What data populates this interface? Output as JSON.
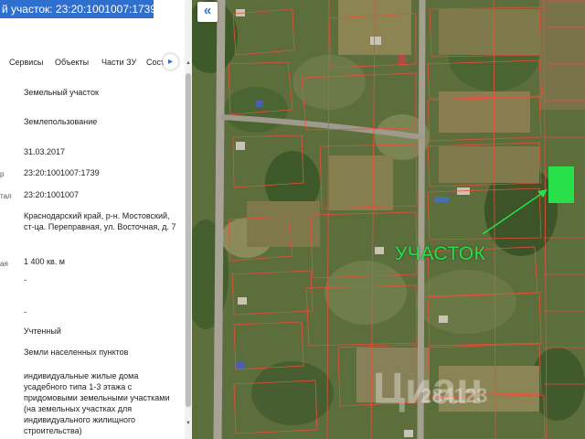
{
  "panel": {
    "title": "й участок: 23:20:1001007:1739",
    "tabs": [
      "Сервисы",
      "Объекты",
      "Части ЗУ",
      "Соста"
    ],
    "tab_next_icon": "chevron-right-icon",
    "rows": [
      {
        "label": "",
        "value": "Земельный участок"
      },
      {
        "label": "",
        "value": "Землепользование"
      },
      {
        "label": "",
        "value": "31.03.2017"
      },
      {
        "label": "р",
        "value": "23:20:1001007:1739"
      },
      {
        "label": "тал",
        "value": "23:20:1001007"
      },
      {
        "label": "",
        "value": "Краснодарский край, р-н. Мостовский, ст-ца. Переправная, ул. Восточная, д. 7"
      },
      {
        "label": "ая",
        "value": "1 400 кв. м"
      },
      {
        "label": "",
        "value": "-"
      },
      {
        "label": "",
        "value": "-"
      },
      {
        "label": "",
        "value": "Учтенный"
      },
      {
        "label": "",
        "value": "Земли населенных пунктов"
      },
      {
        "label": "",
        "value": "индивидуальные жилые дома усадебного типа 1-3 этажа с придомовыми земельными участками (на земельных участках для индивидуального жилищного строительства)"
      }
    ]
  },
  "map": {
    "collapse_icon": "double-chevron-left-icon",
    "collapse_label": "«",
    "parcel_label": "УЧАСТОК",
    "watermark_logo": "Циан",
    "watermark_id": "284123",
    "colors": {
      "accent": "#2f6fd0",
      "highlight": "#27e04a",
      "boundary": "#e8503a",
      "satellite_base": "#5d6e3d"
    }
  }
}
